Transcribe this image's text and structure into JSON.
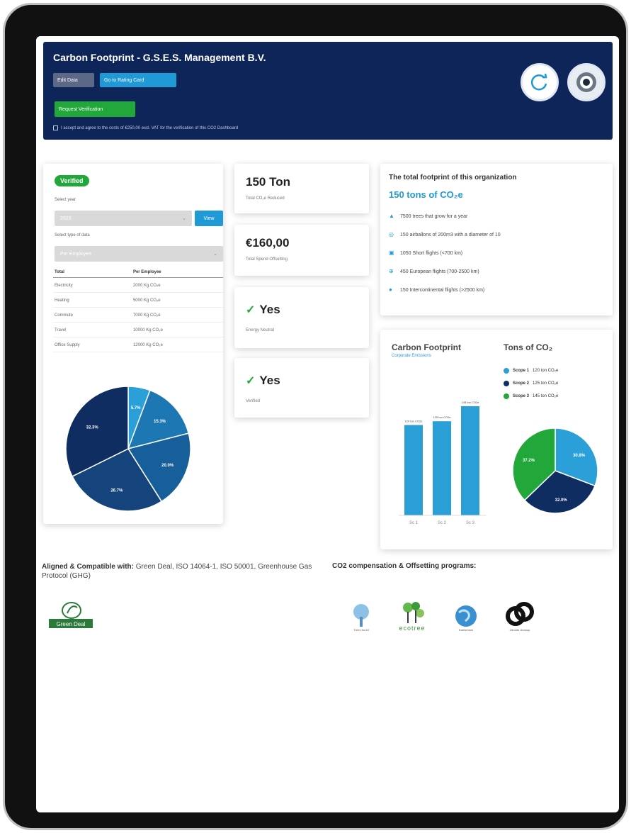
{
  "header": {
    "title": "Carbon Footprint - G.S.E.S. Management B.V.",
    "edit_label": "Edit Data",
    "rating_label": "Go to Rating Card",
    "verify_label": "Request Verification",
    "agree_text": "I accept and agree to the costs of €250,00 excl. VAT for the verification of this CO2 Dashboard",
    "icons": [
      "refresh-icon",
      "badge-icon"
    ]
  },
  "left": {
    "badge": "Verified",
    "year_label": "Select year",
    "year_value": "2023",
    "view_label": "View",
    "type_label": "Select type of data",
    "type_value": "Per Employee",
    "table": {
      "headers": [
        "Total",
        "Per Employee"
      ],
      "rows": [
        [
          "Electricity",
          "2000 Kg CO₂e"
        ],
        [
          "Heating",
          "5000 Kg CO₂e"
        ],
        [
          "Commute",
          "7000 Kg CO₂e"
        ],
        [
          "Travel",
          "10000 Kg CO₂e"
        ],
        [
          "Office Supply",
          "12000 Kg CO₂e"
        ]
      ]
    },
    "pie": [
      {
        "label": "5.7%",
        "value": 5.7,
        "color": "#2a9fd8"
      },
      {
        "label": "15.3%",
        "value": 15.3,
        "color": "#1d77b3"
      },
      {
        "label": "20.0%",
        "value": 20.0,
        "color": "#175f9a"
      },
      {
        "label": "26.7%",
        "value": 26.7,
        "color": "#15437c"
      },
      {
        "label": "32.3%",
        "value": 32.3,
        "color": "#0f2d60"
      }
    ]
  },
  "stats": [
    {
      "big": "150 Ton",
      "small": "Total CO₂e Reduced",
      "check": false
    },
    {
      "big": "€160,00",
      "small": "Total Spend Offsetting",
      "check": false
    },
    {
      "big": "Yes",
      "small": "Energy Neutral",
      "check": true
    },
    {
      "big": "Yes",
      "small": "Verified",
      "check": true
    }
  ],
  "total": {
    "title": "The total footprint of this organization",
    "big": "150 tons of CO₂e",
    "items": [
      {
        "icon": "tree-icon",
        "text": "7500 trees that grow for a year"
      },
      {
        "icon": "balloon-icon",
        "text": "150 airballons of 200m3 with a diameter of 10"
      },
      {
        "icon": "plane-short-icon",
        "text": "1050 Short flights (<700 km)"
      },
      {
        "icon": "plane-eu-icon",
        "text": "450 European flights (700-2500 km)"
      },
      {
        "icon": "globe-icon",
        "text": "150 Intercontinental flights (>2500 km)"
      }
    ]
  },
  "chart_data": [
    {
      "type": "bar",
      "title": "Carbon Footprint",
      "subtitle": "Corporate Emissions",
      "categories": [
        "Sc 1",
        "Sc 2",
        "Sc 3"
      ],
      "values": [
        120,
        125,
        145
      ],
      "data_labels": [
        "120 ton CO2e",
        "125 ton CO2e",
        "145 ton CO2e"
      ],
      "color": "#2a9fd8",
      "ylim": [
        0,
        160
      ]
    },
    {
      "type": "pie",
      "title": "Tons of CO₂",
      "series": [
        {
          "name": "Scope 1",
          "legend": "120 ton CO₂e",
          "value": 120,
          "label": "30.8%",
          "color": "#2a9fd8"
        },
        {
          "name": "Scope 2",
          "legend": "125 ton CO₂e",
          "value": 125,
          "label": "32.0%",
          "color": "#0f2d60"
        },
        {
          "name": "Scope 3",
          "legend": "145 ton CO₂e",
          "value": 145,
          "label": "37.2%",
          "color": "#22a83a"
        }
      ]
    }
  ],
  "footer": {
    "aligned_bold": "Aligned & Compatible with:",
    "aligned_rest": " Green Deal, ISO 14064-1, ISO 50001, Greenhouse Gas Protocol (GHG)",
    "gd_logo": "Green Deal",
    "offset_title": "CO2 compensation & Offsetting programs:",
    "partners": [
      "Trees for All",
      "ecotree",
      "Earthcheck",
      "Climate cleanup"
    ]
  }
}
